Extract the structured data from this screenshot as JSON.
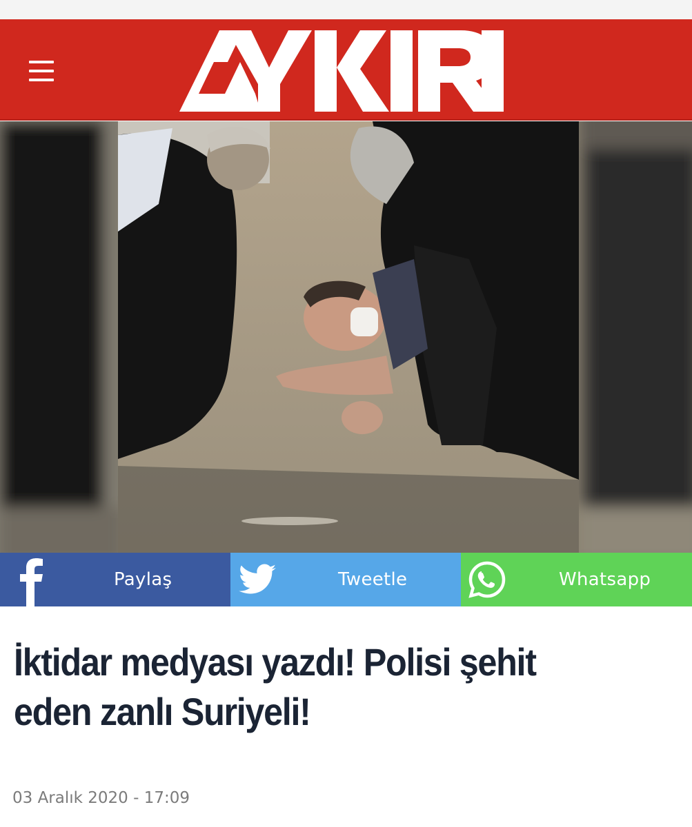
{
  "header": {
    "logo_text": "AYKIRI",
    "menu_icon": "hamburger-menu-icon",
    "background_color": "#d0281e"
  },
  "hero_image": {
    "icon": "news-photo"
  },
  "share_bar": {
    "facebook": {
      "label": "Paylaş",
      "icon": "facebook-icon",
      "color": "#3b5aa0"
    },
    "twitter": {
      "label": "Tweetle",
      "icon": "twitter-bird-icon",
      "color": "#56a7e8"
    },
    "whatsapp": {
      "label": "Whatsapp",
      "icon": "whatsapp-icon",
      "color": "#5fd357"
    }
  },
  "article": {
    "title": "İktidar medyası yazdı! Polisi şehit eden zanlı Suriyeli!",
    "date": "03 Aralık 2020 - 17:09"
  }
}
